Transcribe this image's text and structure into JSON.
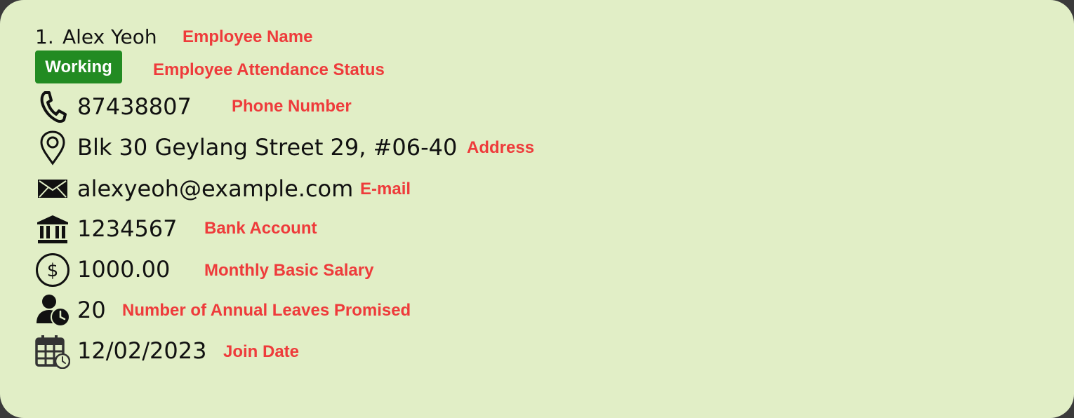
{
  "employee": {
    "index": "1.",
    "name": "Alex Yeoh",
    "status": "Working",
    "phone": "87438807",
    "address": "Blk 30 Geylang Street 29, #06-40",
    "email": "alexyeoh@example.com",
    "bank_account": "1234567",
    "salary": "1000.00",
    "annual_leaves": "20",
    "join_date": "12/02/2023"
  },
  "annotations": {
    "name": "Employee Name",
    "status": "Employee Attendance Status",
    "phone": "Phone Number",
    "address": "Address",
    "email": "E-mail",
    "bank_account": "Bank Account",
    "salary": "Monthly Basic Salary",
    "annual_leaves": "Number of Annual Leaves Promised",
    "join_date": "Join Date"
  },
  "colors": {
    "card_background": "#e1eec6",
    "status_badge": "#228b22",
    "annotation_text": "#ee3b3b"
  },
  "icons": {
    "phone": "phone-icon",
    "address": "location-pin-icon",
    "email": "envelope-icon",
    "bank_account": "bank-icon",
    "salary": "dollar-circle-icon",
    "annual_leaves": "user-clock-icon",
    "join_date": "calendar-clock-icon"
  }
}
